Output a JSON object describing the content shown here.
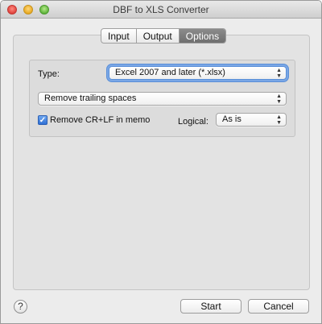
{
  "window": {
    "title": "DBF to XLS Converter"
  },
  "tabs": [
    {
      "label": "Input",
      "active": false
    },
    {
      "label": "Output",
      "active": false
    },
    {
      "label": "Options",
      "active": true
    }
  ],
  "options": {
    "type_label": "Type:",
    "type_value": "Excel 2007 and later (*.xlsx)",
    "trailing_value": "Remove trailing spaces",
    "remove_crlf_label": "Remove CR+LF in memo",
    "remove_crlf_checked": true,
    "logical_label": "Logical:",
    "logical_value": "As is"
  },
  "footer": {
    "help_symbol": "?",
    "start_label": "Start",
    "cancel_label": "Cancel"
  },
  "icons": {
    "popup_arrows": "up-down-chevron-icon",
    "checkbox": "checkmark-icon",
    "help": "question-mark-icon"
  },
  "colors": {
    "active_tab": "#7a7a7a",
    "focus_ring": "#5a8fd8",
    "checkbox": "#3b7ddb"
  }
}
